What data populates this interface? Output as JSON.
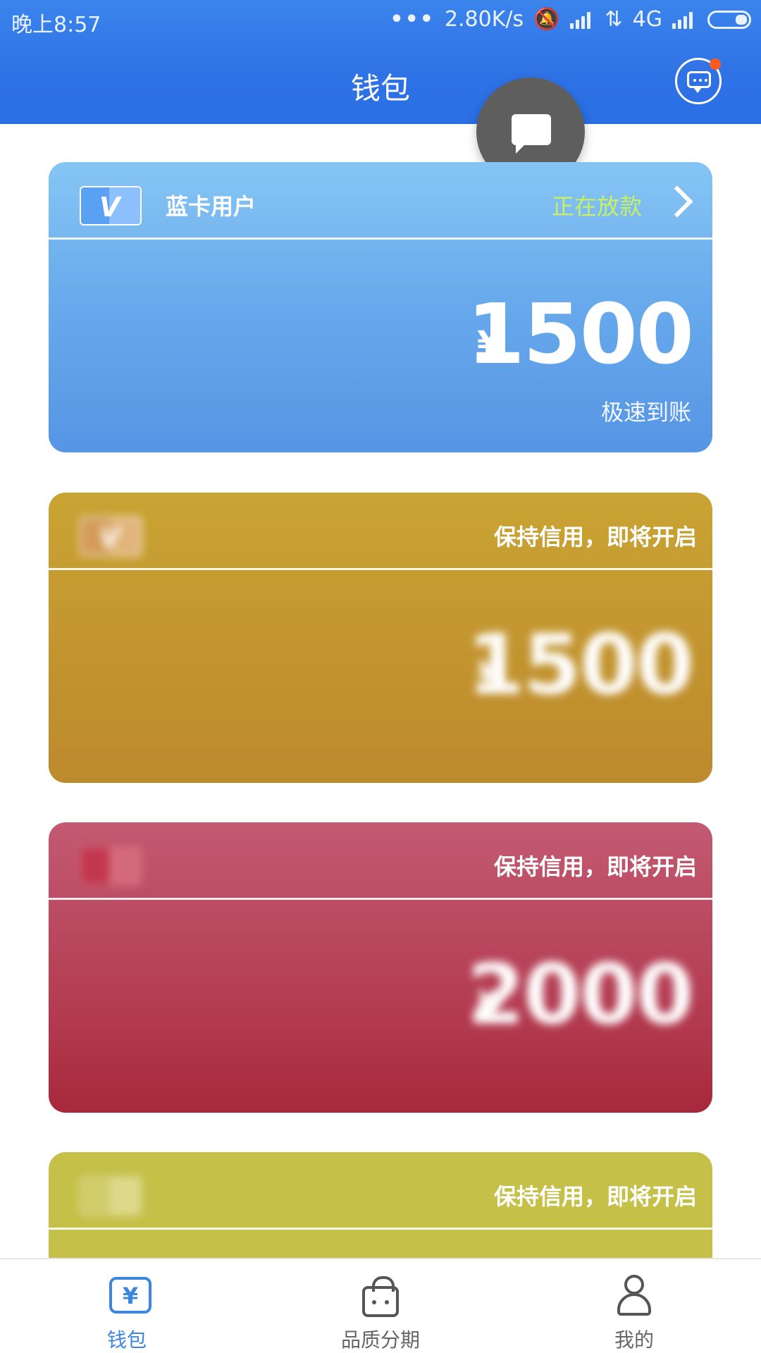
{
  "status_bar": {
    "time": "晚上8:57",
    "dots": "•••",
    "speed": "2.80K/s",
    "network": "4G"
  },
  "header": {
    "title": "钱包"
  },
  "cards": [
    {
      "color": "#5aa1f4",
      "name": "蓝卡用户",
      "status": "正在放款",
      "currency": "¥",
      "amount": "1500",
      "subtitle": "极速到账"
    },
    {
      "color": "#c2932f",
      "name": "",
      "status": "保持信用，即将开启",
      "currency": "¥",
      "amount": "1500",
      "subtitle": ""
    },
    {
      "color": "#b2394e",
      "name": "",
      "status": "保持信用，即将开启",
      "currency": "¥",
      "amount": "2000",
      "subtitle": ""
    },
    {
      "color": "#c4c048",
      "name": "",
      "status": "保持信用，即将开启"
    }
  ],
  "tabbar": {
    "tabs": [
      {
        "label": "钱包",
        "icon": "wallet-icon",
        "active": true
      },
      {
        "label": "品质分期",
        "icon": "shopping-bag-icon",
        "active": false
      },
      {
        "label": "我的",
        "icon": "user-icon",
        "active": false
      }
    ]
  }
}
